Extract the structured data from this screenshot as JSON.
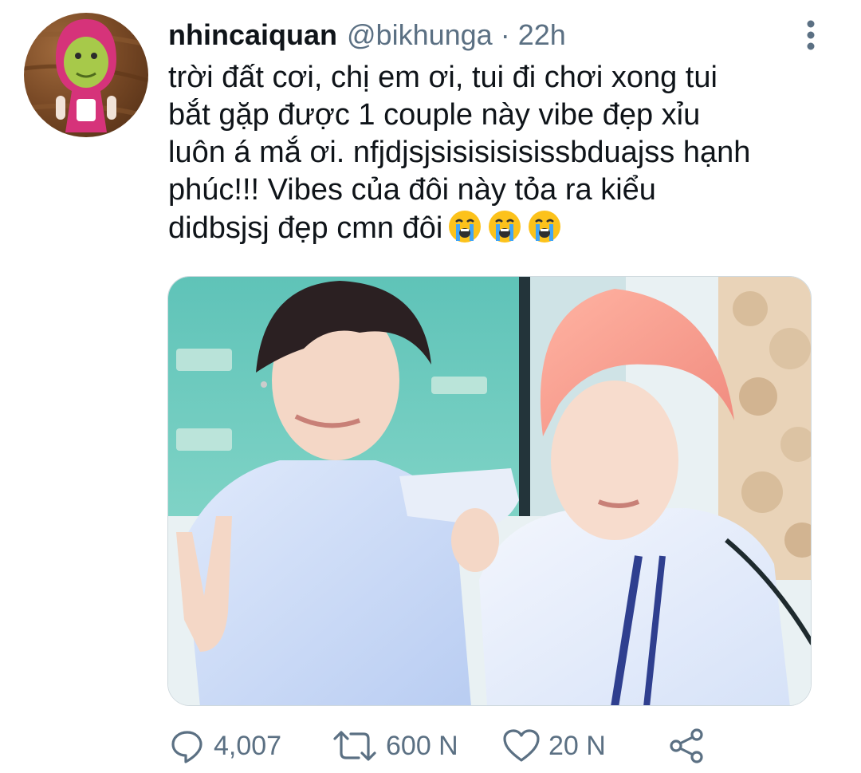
{
  "tweet": {
    "display_name": "nhincaiquan",
    "handle": "@bikhunga",
    "separator": "·",
    "time": "22h",
    "text_lines": [
      "trời đất cơi, chị em ơi, tui đi chơi xong tui",
      "bắt gặp được 1 couple này vibe đẹp xỉu",
      "luôn á mắ ơi. nfjdjsjsisisisisissbduajss hạnh",
      "phúc!!! Vibes của đôi này tỏa ra kiểu",
      "didbsjsj đẹp cmn đôi"
    ],
    "emojis": [
      "loudly-crying-face",
      "loudly-crying-face",
      "loudly-crying-face"
    ]
  },
  "actions": {
    "reply": {
      "icon": "reply-icon",
      "count": "4,007"
    },
    "retweet": {
      "icon": "retweet-icon",
      "count": "600 N"
    },
    "like": {
      "icon": "heart-icon",
      "count": "20 N"
    },
    "share": {
      "icon": "share-icon"
    }
  },
  "colors": {
    "text_primary": "#0f1419",
    "text_secondary": "#5b7083",
    "emoji_face": "#fcc21b",
    "tears": "#42a5f5"
  }
}
